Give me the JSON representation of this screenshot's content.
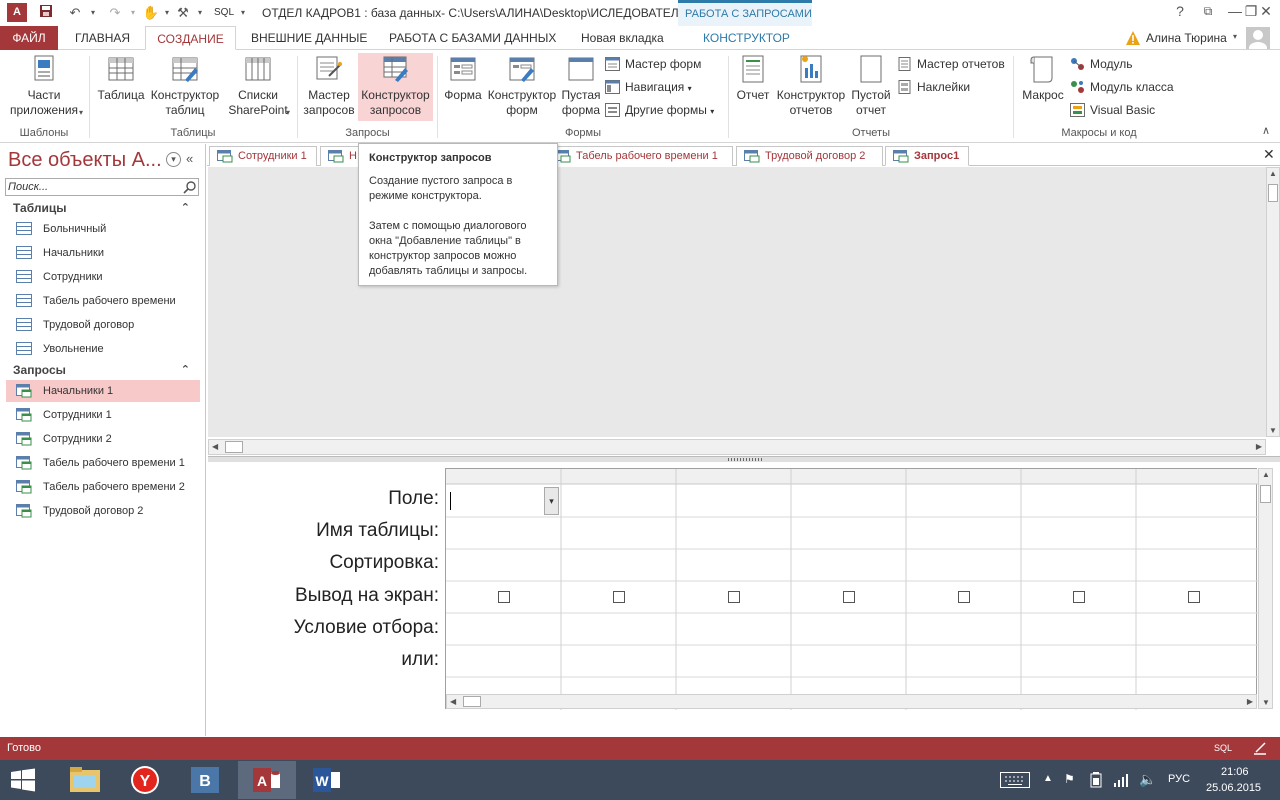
{
  "title_bar": {
    "title": "ОТДЕЛ КАДРОВ1 : база данных- C:\\Users\\АЛИНА\\Desktop\\ИСЛЕДОВАТЕЛ...",
    "sql_label": "SQL",
    "contextual_header": "РАБОТА С ЗАПРОСАМИ",
    "help": "?",
    "minimize": "—",
    "restore": "❐",
    "close": "✕"
  },
  "tabs": {
    "file": "ФАЙЛ",
    "home": "ГЛАВНАЯ",
    "create": "СОЗДАНИЕ",
    "external": "ВНЕШНИЕ ДАННЫЕ",
    "db_tools": "РАБОТА С БАЗАМИ ДАННЫХ",
    "new_tab": "Новая вкладка",
    "constructor": "КОНСТРУКТОР",
    "user": "Алина Тюрина"
  },
  "ribbon": {
    "app_parts_1": "Части",
    "app_parts_2": "приложения",
    "table": "Таблица",
    "table_designer_1": "Конструктор",
    "table_designer_2": "таблиц",
    "sharepoint_1": "Списки",
    "sharepoint_2": "SharePoint",
    "query_wizard_1": "Мастер",
    "query_wizard_2": "запросов",
    "query_designer_1": "Конструктор",
    "query_designer_2": "запросов",
    "form": "Форма",
    "form_designer_1": "Конструктор",
    "form_designer_2": "форм",
    "blank_form_1": "Пустая",
    "blank_form_2": "форма",
    "form_wizard": "Мастер форм",
    "navigation": "Навигация",
    "other_forms": "Другие формы",
    "report": "Отчет",
    "report_designer_1": "Конструктор",
    "report_designer_2": "отчетов",
    "blank_report_1": "Пустой",
    "blank_report_2": "отчет",
    "report_wizard": "Мастер отчетов",
    "labels": "Наклейки",
    "macro": "Макрос",
    "module": "Модуль",
    "class_module": "Модуль класса",
    "visual_basic": "Visual Basic",
    "groups": {
      "templates": "Шаблоны",
      "tables": "Таблицы",
      "queries": "Запросы",
      "forms": "Формы",
      "reports": "Отчеты",
      "macros": "Макросы и код"
    }
  },
  "nav": {
    "header": "Все объекты А...",
    "search_placeholder": "Поиск...",
    "tables_section": "Таблицы",
    "tables": [
      "Больничный",
      "Начальники",
      "Сотрудники",
      "Табель рабочего времени",
      "Трудовой договор",
      "Увольнение"
    ],
    "queries_section": "Запросы",
    "queries": [
      "Начальники 1",
      "Сотрудники 1",
      "Сотрудники 2",
      "Табель рабочего времени 1",
      "Табель рабочего времени 2",
      "Трудовой договор 2"
    ]
  },
  "doc_tabs": [
    "Сотрудники 1",
    "Н",
    "Табель рабочего времени 1",
    "Трудовой договор 2",
    "Запрос1"
  ],
  "tooltip": {
    "title": "Конструктор запросов",
    "line1": "Создание пустого запроса в режиме конструктора.",
    "line2": "Затем с помощью диалогового окна \"Добавление таблицы\" в конструктор запросов можно добавлять таблицы и запросы."
  },
  "grid_rows": [
    "Поле:",
    "Имя таблицы:",
    "Сортировка:",
    "Вывод на экран:",
    "Условие отбора:",
    "или:"
  ],
  "status": {
    "ready": "Готово",
    "sql": "SQL"
  },
  "taskbar": {
    "lang": "РУС",
    "time": "21:06",
    "date": "25.06.2015"
  },
  "colors": {
    "accent": "#a4373a",
    "contextual": "#2e7aa8",
    "selection": "#f8c9c9"
  }
}
